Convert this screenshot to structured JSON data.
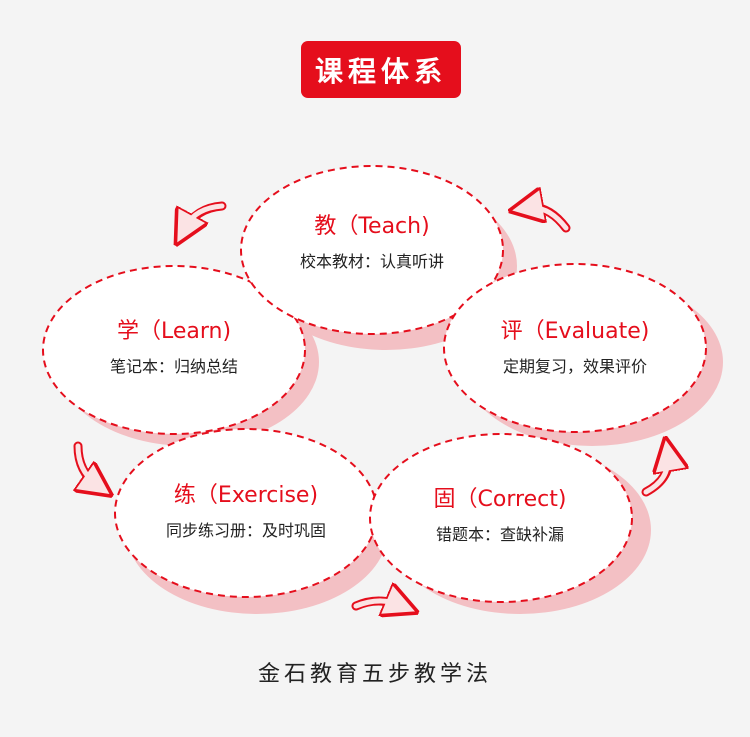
{
  "title": "课程体系",
  "nodes": [
    {
      "id": "teach",
      "name": "教（Teach)",
      "desc": "校本教材：认真听讲"
    },
    {
      "id": "learn",
      "name": "学（Learn)",
      "desc": "笔记本：归纳总结"
    },
    {
      "id": "evaluate",
      "name": "评（Evaluate)",
      "desc": "定期复习，效果评价"
    },
    {
      "id": "exercise",
      "name": "练（Exercise)",
      "desc": "同步练习册：及时巩固"
    },
    {
      "id": "correct",
      "name": "固（Correct)",
      "desc": "错题本：查缺补漏"
    }
  ],
  "footer": "金石教育五步教学法",
  "colors": {
    "accent": "#e50e1c",
    "shadow": "#f3c0c4",
    "background": "#f4f4f4"
  }
}
